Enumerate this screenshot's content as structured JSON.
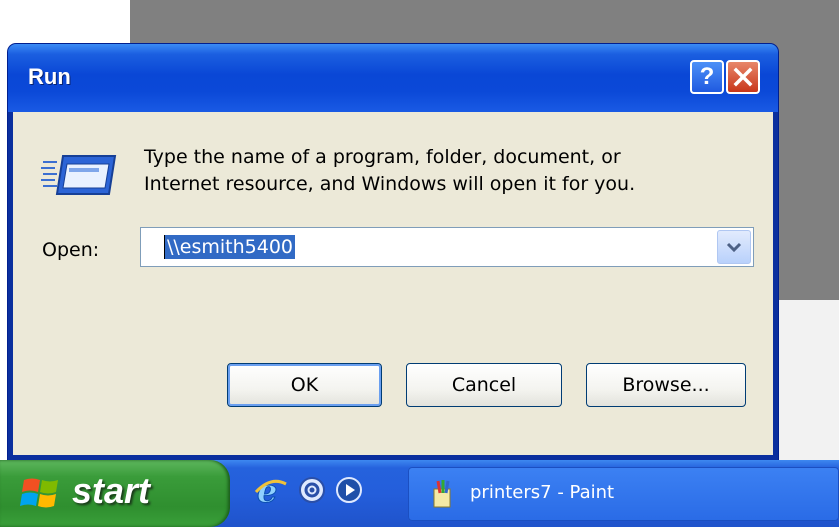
{
  "dialog": {
    "title": "Run",
    "help_button": "?",
    "close_button": "✕",
    "description_line1": "Type the name of a program, folder, document, or",
    "description_line2": "Internet resource, and Windows will open it for you.",
    "open_label": "Open:",
    "open_value": "\\\\esmith5400",
    "buttons": {
      "ok": "OK",
      "cancel": "Cancel",
      "browse": "Browse..."
    }
  },
  "taskbar": {
    "start_label": "start",
    "quick_launch": [
      "internet-explorer-icon",
      "outlook-express-icon",
      "media-player-icon"
    ],
    "tasks": [
      {
        "label": "printers7 - Paint",
        "icon": "paint-icon"
      }
    ]
  },
  "colors": {
    "title_bar": "#0a47d6",
    "dialog_face": "#ece9d8",
    "selection": "#316ac5",
    "taskbar": "#245edb",
    "start_button": "#3a9c3a",
    "close_button": "#c8361a"
  }
}
